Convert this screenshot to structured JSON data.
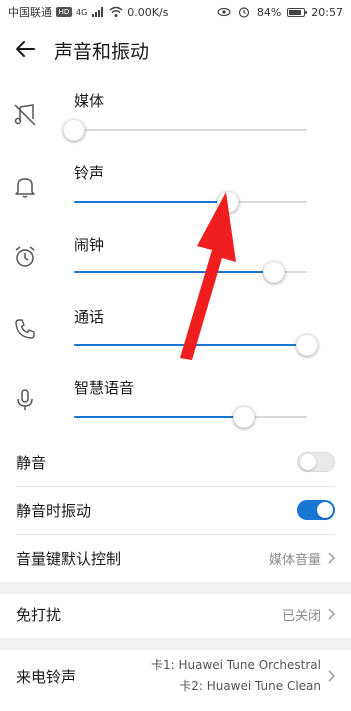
{
  "status_bar": {
    "carrier": "中国联通",
    "hd_badge": "HD",
    "network": "4G",
    "speed": "0.00K/s",
    "battery_percent": "84%",
    "battery_level": 0.84,
    "time": "20:57"
  },
  "header": {
    "title": "声音和振动"
  },
  "volumes": [
    {
      "label": "媒体",
      "icon": "media-muted-icon",
      "level": 0.0
    },
    {
      "label": "铃声",
      "icon": "bell-icon",
      "level": 0.66
    },
    {
      "label": "闹钟",
      "icon": "alarm-clock-icon",
      "level": 0.86
    },
    {
      "label": "通话",
      "icon": "phone-icon",
      "level": 1.0
    },
    {
      "label": "智慧语音",
      "icon": "microphone-icon",
      "level": 0.73
    }
  ],
  "settings": {
    "mute_label": "静音",
    "mute_on": false,
    "vibrate_on_mute_label": "静音时振动",
    "vibrate_on_mute_on": true,
    "volume_key_label": "音量键默认控制",
    "volume_key_value": "媒体音量",
    "dnd_label": "免打扰",
    "dnd_value": "已关闭",
    "ringtone_label": "来电铃声",
    "ringtone_sim1": "卡1: Huawei Tune Orchestral",
    "ringtone_sim2": "卡2: Huawei Tune Clean"
  },
  "colors": {
    "accent": "#1976d2",
    "annotation_arrow": "#f01e1e"
  }
}
